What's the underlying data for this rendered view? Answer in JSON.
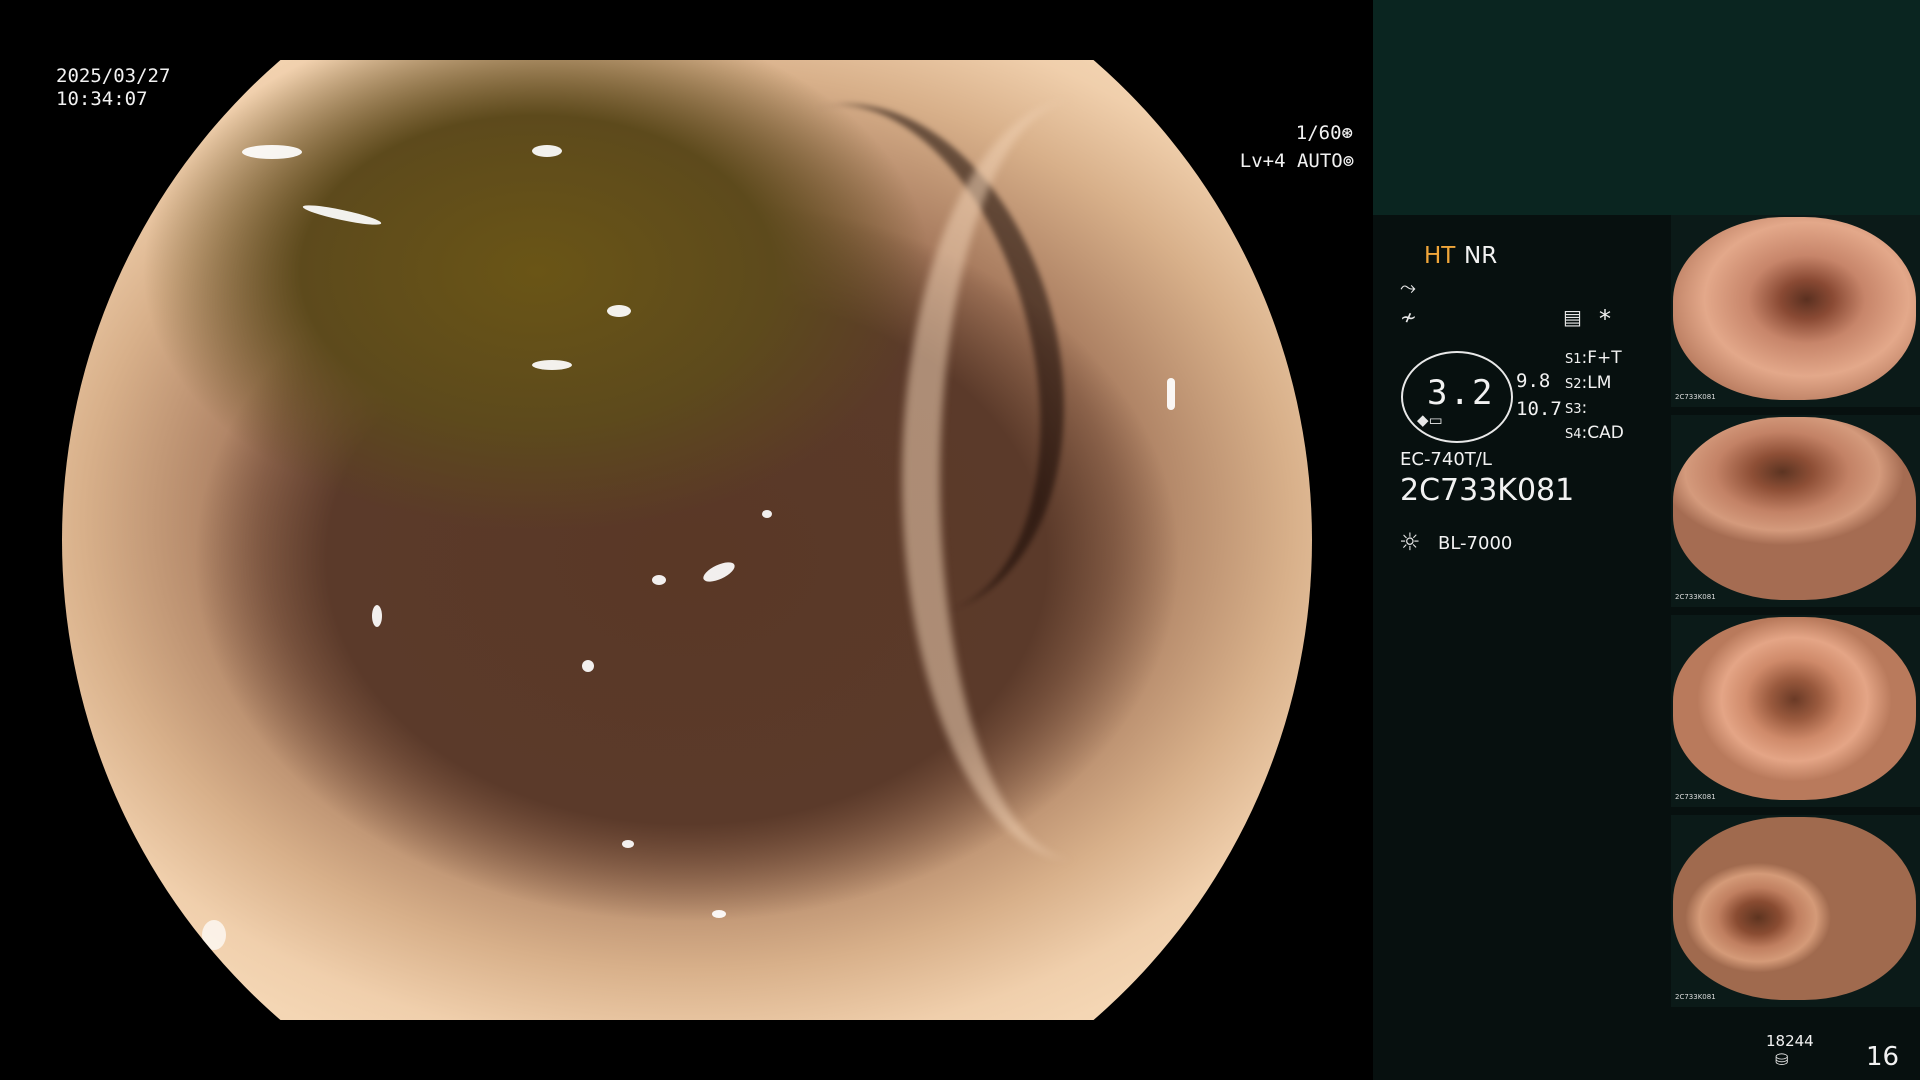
{
  "main_view": {
    "date": "2025/03/27",
    "time": "10:34:07",
    "shutter": "1/60",
    "level": "Lv+4",
    "exposure_mode": "AUTO",
    "shutter_icon": "aperture-icon",
    "auto_icon": "auto-exposure-icon"
  },
  "panel": {
    "ht_label": "HT",
    "nr_label": "NR",
    "mode_icon_1": "zoom-curve-icon",
    "mode_icon_2": "enhance-off-icon",
    "menu_icon": "menu-list-icon",
    "star_label": "*",
    "zoom_value": "3.2",
    "reading_1": "9.8",
    "reading_2": "10.7",
    "switches": [
      {
        "key": "S1",
        "value": "F+T"
      },
      {
        "key": "S2",
        "value": "LM"
      },
      {
        "key": "S3",
        "value": ""
      },
      {
        "key": "S4",
        "value": "CAD"
      }
    ],
    "scope_model": "EC-740T/L",
    "serial": "2C733K081",
    "light_source": "BL-7000",
    "light_icon": "light-source-icon",
    "storage_count": "18244",
    "storage_icon": "storage-icon",
    "image_count": "16"
  },
  "thumbnails": [
    {
      "label": "thumbnail-1",
      "serial": "2C733K081",
      "mucosa": "#d89a7c",
      "lumen": "#5a3020"
    },
    {
      "label": "thumbnail-2",
      "serial": "2C733K081",
      "mucosa": "#c98a68",
      "lumen": "#5c3422"
    },
    {
      "label": "thumbnail-3",
      "serial": "2C733K081",
      "mucosa": "#d6916e",
      "lumen": "#6a3a26"
    },
    {
      "label": "thumbnail-4",
      "serial": "2C733K081",
      "mucosa": "#c98866",
      "lumen": "#5e3420"
    }
  ],
  "colors": {
    "panel_bg": "#07100f",
    "panel_top": "#0a2520",
    "ht_accent": "#f0a63a"
  }
}
